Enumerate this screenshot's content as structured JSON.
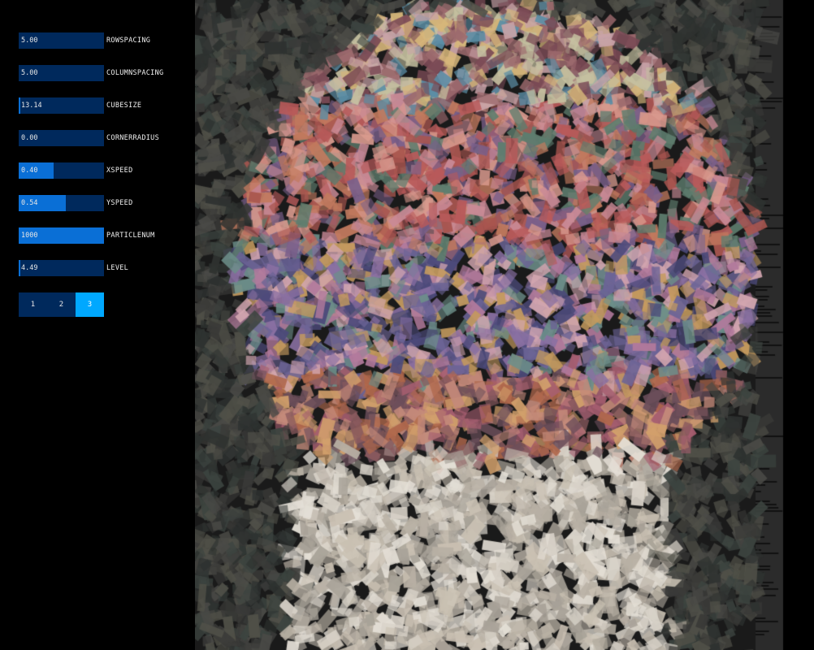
{
  "controls": {
    "sliders": [
      {
        "label": "ROWSPACING",
        "value": "5.00",
        "level": 0
      },
      {
        "label": "COLUMNSPACING",
        "value": "5.00",
        "level": 0
      },
      {
        "label": "CUBESIZE",
        "value": "13.14",
        "level": 0.02
      },
      {
        "label": "CORNERRADIUS",
        "value": "0.00",
        "level": 0
      },
      {
        "label": "XSPEED",
        "value": "0.40",
        "level": 0.41
      },
      {
        "label": "YSPEED",
        "value": "0.54",
        "level": 0.55
      },
      {
        "label": "PARTICLENUM",
        "value": "1000",
        "level": 1.0
      },
      {
        "label": "LEVEL",
        "value": "4.49",
        "level": 0.02
      }
    ],
    "radio": {
      "options": [
        "1",
        "2",
        "3"
      ],
      "selected": "3"
    }
  },
  "colors": {
    "panel_bg": "#000000",
    "slider_bg": "#00295c",
    "slider_fill": "#0a6fd6",
    "radio_active": "#00a8ff",
    "sidebar_strip": "#2b2b2b"
  }
}
